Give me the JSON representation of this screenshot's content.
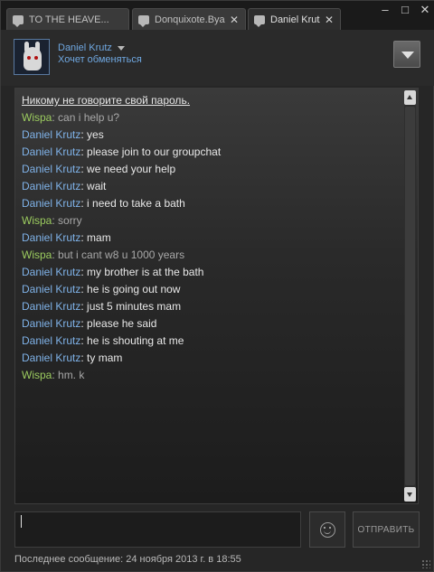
{
  "tabs": [
    {
      "label": "TO THE HEAVE..."
    },
    {
      "label": "Donquixote.Bya"
    },
    {
      "label": "Daniel Krutz"
    }
  ],
  "window_controls": {
    "minimize": "–",
    "maximize": "□",
    "close": "✕"
  },
  "header": {
    "name": "Daniel Krutz",
    "status": "Хочет обменяться"
  },
  "notice": "Никому не говорите свой пароль.",
  "messages": [
    {
      "sender": "Wispa",
      "text": "can i help u?",
      "self": false
    },
    {
      "sender": "Daniel Krutz",
      "text": "yes",
      "self": true
    },
    {
      "sender": "Daniel Krutz",
      "text": "please join to our groupchat",
      "self": true
    },
    {
      "sender": "Daniel Krutz",
      "text": "we need your help",
      "self": true
    },
    {
      "sender": "Daniel Krutz",
      "text": "wait",
      "self": true
    },
    {
      "sender": "Daniel Krutz",
      "text": "i need to take a bath",
      "self": true
    },
    {
      "sender": "Wispa",
      "text": "sorry",
      "self": false
    },
    {
      "sender": "Daniel Krutz",
      "text": "mam",
      "self": true
    },
    {
      "sender": "Wispa",
      "text": "but i cant w8 u 1000 years",
      "self": false
    },
    {
      "sender": "Daniel Krutz",
      "text": "my brother is at the bath",
      "self": true
    },
    {
      "sender": "Daniel Krutz",
      "text": "he is going out now",
      "self": true
    },
    {
      "sender": "Daniel Krutz",
      "text": "just 5 minutes mam",
      "self": true
    },
    {
      "sender": "Daniel Krutz",
      "text": "please he said",
      "self": true
    },
    {
      "sender": "Daniel Krutz",
      "text": "he is shouting at me",
      "self": true
    },
    {
      "sender": "Daniel Krutz",
      "text": "ty mam",
      "self": true
    },
    {
      "sender": "Wispa",
      "text": "hm. k",
      "self": false
    }
  ],
  "input": {
    "value": ""
  },
  "send_label": "ОТПРАВИТЬ",
  "footer": "Последнее сообщение: 24 ноября 2013 г. в 18:55",
  "colors": {
    "self_sender": "#7fb2e8",
    "other_sender": "#9ccc5f",
    "background": "#262626"
  }
}
